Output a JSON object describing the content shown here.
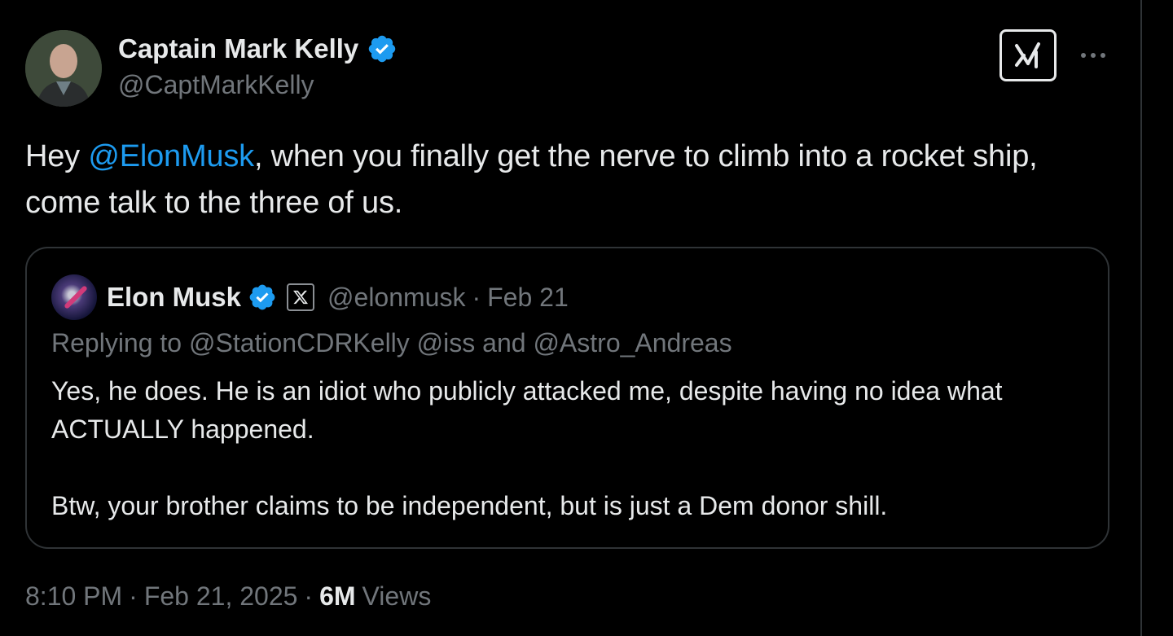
{
  "author": {
    "name": "Captain Mark Kelly",
    "handle": "@CaptMarkKelly"
  },
  "tweet": {
    "text_before": "Hey ",
    "mention": "@ElonMusk",
    "text_after": ", when you finally get the nerve to climb into a rocket ship, come talk to the three of us."
  },
  "quote": {
    "name": "Elon Musk",
    "handle": "@elonmusk",
    "separator": "·",
    "date": "Feb 21",
    "reply_line": "Replying to @StationCDRKelly @iss and @Astro_Andreas",
    "body_paragraph_1": "Yes, he does. He is an idiot who publicly attacked me, despite having no idea what ACTUALLY happened.",
    "body_paragraph_2": "Btw, your brother claims to be independent, but is just a Dem donor shill."
  },
  "meta": {
    "time": "8:10 PM",
    "separator": "·",
    "date": "Feb 21, 2025",
    "views_count": "6M",
    "views_label": "Views"
  },
  "colors": {
    "background": "#000000",
    "primary_text": "#e7e9ea",
    "secondary_text": "#71767b",
    "link": "#1d9bf0",
    "verified": "#1d9bf0",
    "border": "#2f3336"
  },
  "icons": {
    "verified": "verified-badge-icon",
    "grok": "grok-icon",
    "more": "more-horizontal-icon",
    "x_affiliate": "x-logo-icon"
  }
}
